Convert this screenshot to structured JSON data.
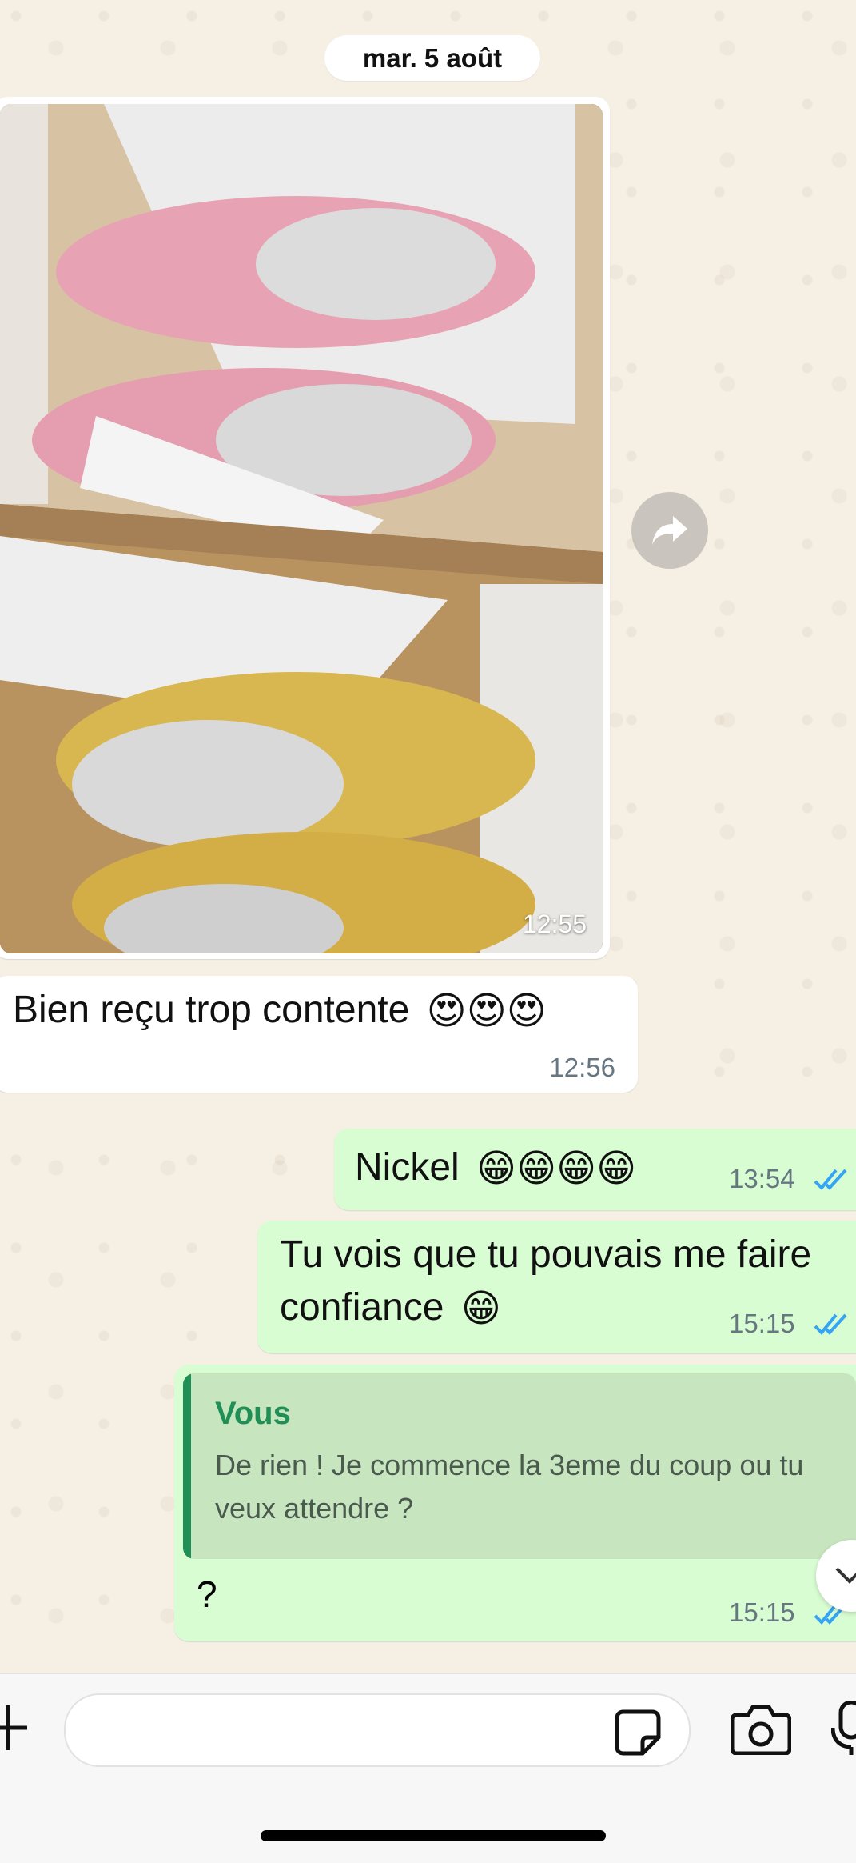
{
  "date_separator": "mar. 5 août",
  "messages": {
    "photo": {
      "time": "12:55"
    },
    "received_text": {
      "text": "Bien reçu trop contente",
      "emoji": "😍😍😍",
      "time": "12:56"
    },
    "sent_1": {
      "text": "Nickel",
      "emoji": "😁😁😁😁",
      "time": "13:54",
      "status": "read"
    },
    "sent_2": {
      "line1": "Tu vois que tu pouvais me faire",
      "line2": "confiance",
      "emoji": "😁",
      "time": "15:15",
      "status": "read"
    },
    "sent_3": {
      "quote_author": "Vous",
      "quote_text": "De rien ! Je commence la 3eme du coup ou tu veux attendre ?",
      "text": "?",
      "time": "15:15",
      "status": "read"
    }
  },
  "composer": {
    "placeholder": "",
    "icons": [
      "plus-icon",
      "sticker-icon",
      "camera-icon",
      "microphone-icon"
    ]
  },
  "colors": {
    "outgoing_bubble": "#d9fdd3",
    "incoming_bubble": "#ffffff",
    "read_ticks": "#34a4f5",
    "quote_accent": "#1f8f55"
  }
}
